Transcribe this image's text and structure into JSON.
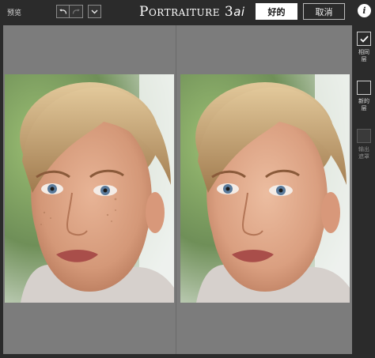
{
  "toolbar": {
    "preview_label": "预览",
    "title_main": "Portraiture",
    "title_version": "3",
    "title_suffix": "ai",
    "ok_label": "好的",
    "cancel_label": "取消",
    "info_label": "i"
  },
  "sidebar": {
    "same_layer": {
      "label_line1": "相同",
      "label_line2": "层",
      "checked": true
    },
    "new_layer": {
      "label_line1": "新的",
      "label_line2": "层",
      "checked": false
    },
    "output_mask": {
      "label_line1": "输出",
      "label_line2": "遮罩",
      "enabled": false
    }
  },
  "preview": {
    "panes": [
      "before",
      "after"
    ],
    "background_color": "#7c7c7c"
  }
}
